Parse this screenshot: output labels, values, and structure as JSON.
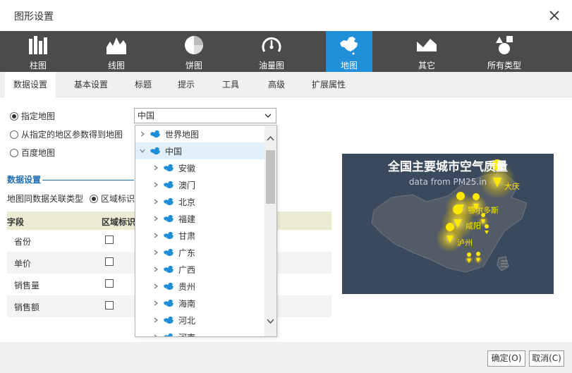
{
  "dialog": {
    "title": "图形设置"
  },
  "chart_types": [
    {
      "label": "柱图",
      "icon": "bar-chart-icon"
    },
    {
      "label": "线图",
      "icon": "line-chart-icon"
    },
    {
      "label": "饼图",
      "icon": "pie-chart-icon"
    },
    {
      "label": "油量图",
      "icon": "gauge-icon"
    },
    {
      "label": "地图",
      "icon": "china-map-icon",
      "active": true
    },
    {
      "label": "其它",
      "icon": "area-chart-icon"
    },
    {
      "label": "所有类型",
      "icon": "shapes-icon"
    }
  ],
  "tabs": [
    {
      "label": "数据设置",
      "active": true
    },
    {
      "label": "基本设置"
    },
    {
      "label": "标题"
    },
    {
      "label": "提示"
    },
    {
      "label": "工具"
    },
    {
      "label": "高级"
    },
    {
      "label": "扩展属性"
    }
  ],
  "map_source": {
    "options": [
      "指定地图",
      "从指定的地区参数得到地图",
      "百度地图"
    ],
    "selected": "指定地图",
    "map_value": "中国"
  },
  "data_section": {
    "title": "数据设置",
    "assoc_label": "地图同数据关联类型",
    "assoc_option": "区域标识"
  },
  "field_table": {
    "headers": [
      "字段",
      "区域标识"
    ],
    "rows": [
      "省份",
      "单价",
      "销售量",
      "销售额"
    ]
  },
  "tree": [
    {
      "label": "世界地图",
      "level": 0,
      "expanded": false
    },
    {
      "label": "中国",
      "level": 0,
      "expanded": true,
      "selected": true
    },
    {
      "label": "安徽",
      "level": 1
    },
    {
      "label": "澳门",
      "level": 1
    },
    {
      "label": "北京",
      "level": 1
    },
    {
      "label": "福建",
      "level": 1
    },
    {
      "label": "甘肃",
      "level": 1
    },
    {
      "label": "广东",
      "level": 1
    },
    {
      "label": "广西",
      "level": 1
    },
    {
      "label": "贵州",
      "level": 1
    },
    {
      "label": "海南",
      "level": 1
    },
    {
      "label": "河北",
      "level": 1
    },
    {
      "label": "河南",
      "level": 1
    }
  ],
  "preview": {
    "title": "全国主要城市空气质量",
    "subtitle": "data from PM25.in",
    "cities": [
      "大庆",
      "鄂尔多斯",
      "咸阳",
      "泸州"
    ]
  },
  "buttons": {
    "ok": "确定(O)",
    "cancel": "取消(C)"
  },
  "colors": {
    "active_type": "#1f8fd7",
    "type_bar": "#4b4b4b",
    "map_blue": "#1f8fd7",
    "city_yellow": "#ffe800"
  }
}
